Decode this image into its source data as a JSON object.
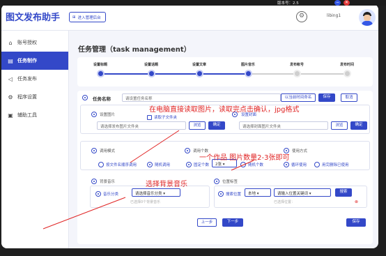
{
  "titlebar": {
    "version": "版本号：2.5",
    "minimize": "−",
    "close": "✕"
  },
  "header": {
    "logo": "图文发布助手",
    "admin_label": "进入管理后台",
    "username": "libing1"
  },
  "sidebar": {
    "items": [
      {
        "label": "账号授权",
        "icon": "⌂",
        "active": false
      },
      {
        "label": "任务制作",
        "icon": "▤",
        "active": true
      },
      {
        "label": "任务发布",
        "icon": "◁",
        "active": false
      },
      {
        "label": "程序设置",
        "icon": "⚙",
        "active": false
      },
      {
        "label": "辅助工具",
        "icon": "▣",
        "active": false
      }
    ]
  },
  "page": {
    "title": "任务管理（task management）"
  },
  "steps": [
    {
      "label": "设置标题",
      "done": true
    },
    {
      "label": "设置话题",
      "done": true
    },
    {
      "label": "设置文章",
      "done": true
    },
    {
      "label": "图片音乐",
      "done": true
    },
    {
      "label": "发布帐号",
      "done": false
    },
    {
      "label": "发布时间",
      "done": false
    }
  ],
  "form": {
    "task_name_label": "任务名称",
    "task_name_placeholder": "请设置任务名称",
    "name_by_time": "以当前时间命名",
    "save": "保存",
    "cancel": "取消",
    "set_image": "设置图片",
    "read_subfolder": "读取子文件夹",
    "set_cover": "设置封面",
    "image_folder_placeholder": "请选择发布图片文件夹",
    "cover_folder_placeholder": "请选择封面图片文件夹",
    "browse": "浏览",
    "confirm": "确定",
    "call_mode": "调用模式",
    "call_mode_opt1": "按文件名顺序调用",
    "call_mode_opt2": "随机调用",
    "call_count": "调用个数",
    "fixed_count": "固定个数",
    "count_value": "2张",
    "random_count": "随机个数",
    "use_mode": "使用方式",
    "loop_use": "循环使用",
    "once_use": "用完删除已使用",
    "bg_music": "背景音乐",
    "music_category": "音乐分类",
    "music_select": "请选择音乐分类",
    "music_selected": "已选择0个背景音乐",
    "location_tag": "位置标签",
    "search_location": "搜索位置",
    "location_city": "本地",
    "location_keyword_placeholder": "请输入位置关键词",
    "search": "搜索",
    "location_selected": "已选择位置：",
    "prev": "上一步",
    "next": "下一步"
  },
  "annotations": {
    "note1": "在电脑直接读取图片，读取完点击确认，jpg格式",
    "note2": "一个作品 图片数量2-3张即可",
    "note3": "选择背景音乐"
  },
  "colors": {
    "accent": "#3348c8",
    "annotation": "#e02424",
    "background": "#f4f5fb"
  }
}
